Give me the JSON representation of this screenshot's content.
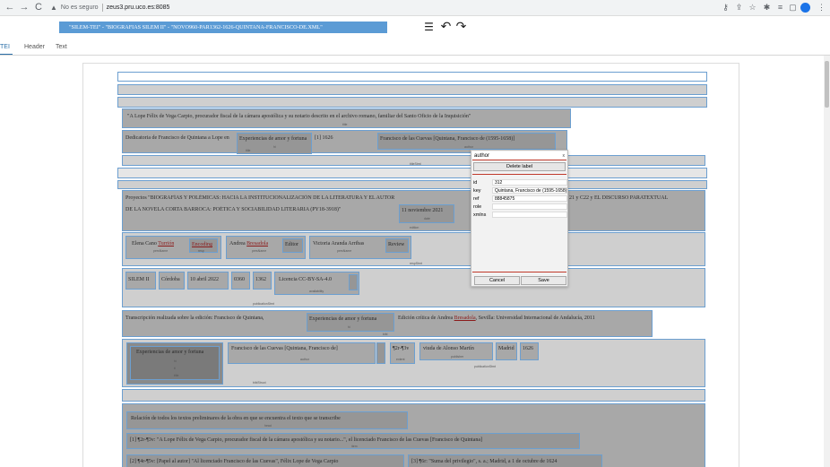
{
  "browser": {
    "security_label": "No es seguro",
    "address": "zeus3.pru.uco.es:8085"
  },
  "header": {
    "title": "\"SILEM-TEI\" - \"BIOGRAFIAS SILEM II\" - \"NOVO960-PAR1362-1626-QUINTANA-FRANCISCO-DE.XML\""
  },
  "tabs": [
    {
      "label": "TEI"
    },
    {
      "label": "Header"
    },
    {
      "label": "Text"
    }
  ],
  "doc": {
    "dedication_heading": "\"A Lope Félix de Vega Carpio, procurador fiscal de la cámara apostólica y su notario descrito en el archivo romano, familiar del Santo Oficio de la Inquisición\"",
    "dedication_line_prefix": "Dedicatoria de Francisco de Quintana a Lope en",
    "work_title": "Experiencias de amor y fortuna",
    "dedication_year": "[1] 1626",
    "author_name": "Francisco de las Cuevas [Quintana, Francisco de (1595-1658)]",
    "project_line1": "Proyectos \"BIOGRAFÍAS Y POLÉMICAS: HACIA LA INSTITUCIONALIZACIÓN DE LA LITERATURA Y EL AUTOR",
    "project_line1_tail": "21 y C22 y EL DISCURSO PARATEXTUAL",
    "project_line2": "DE LA NOVELA CORTA BARROCA: POÉTICA Y SOCIABILIDAD LITERARIA (PY18-3918)\"",
    "project_date": "11 noviembre 2021",
    "resp1_name": "Elena Cano",
    "resp1_surname": "Turrión",
    "resp1_role": "Encoding",
    "resp2_name": "Andrea",
    "resp2_surname": "Bresadola",
    "resp2_role": "Editor",
    "resp3_name": "Victoria Aranda Arribas",
    "resp3_role": "Review",
    "pub_corpus": "SILEM II",
    "pub_place": "Córdoba",
    "pub_date": "10 abril 2022",
    "pub_num1": "0360",
    "pub_num2": "1362",
    "pub_license": "Licencia CC-BY-SA-4.0",
    "source_prefix": "Transcripción realizada sobre la edición: Francisco de Quintana,",
    "source_suffix_pre": "Edición crítica de Andrea",
    "source_editor": "Bresadola",
    "source_suffix": ", Sevilla: Universidad Internacional de Andalucía, 2011",
    "bib_title": "Experiencias de amor y fortuna",
    "bib_author": "Francisco de las Cuevas [Quintana, Francisco de]",
    "bib_pages": "¶2r-¶3v",
    "bib_printer": "viuda de Alonso Martín",
    "bib_place": "Madrid",
    "bib_year": "1626",
    "relation": "Relación de todos los textos preliminares de la obra en que se encuentra el texto que se transcribe",
    "rel_item1": "[1] ¶2r-¶3v: \"A Lope Félix de Vega Carpio, procurador fiscal de la cámara apostólica y su notario...\", el licenciado Francisco de las Cuevas [Francisco de Quintana]",
    "rel_item2_a": "[2] ¶4r-¶5v: [Papel al autor] \"Al licenciado Francisco de las Cuevas\", Félix Lope de Vega Carpio",
    "rel_item2_b": "[3] ¶6r: \"Suma del privilegio\", s. a.; Madrid, a 1 de octubre de 1624"
  },
  "popup": {
    "selected_attr": "author",
    "close_symbol": "x",
    "delete_label": "Delete label",
    "rows": [
      {
        "key": "id",
        "value": "312"
      },
      {
        "key": "key",
        "value": "Quintana, Francisco de (1595-1658)"
      },
      {
        "key": "ref",
        "value": "88845875"
      },
      {
        "key": "role",
        "value": ""
      },
      {
        "key": "xmlns",
        "value": ""
      }
    ],
    "cancel_label": "Cancel",
    "save_label": "Save"
  }
}
